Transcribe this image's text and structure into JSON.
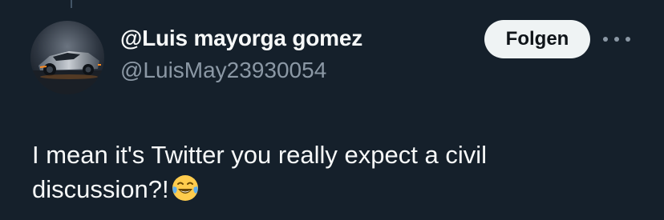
{
  "tweet": {
    "author": {
      "display_name": "@Luis mayorga gomez",
      "handle": "@LuisMay23930054",
      "avatar": "car-avatar"
    },
    "follow_label": "Folgen",
    "more_icon": "more-horizontal-icon",
    "text_line1": "I mean it's Twitter you really expect a civil",
    "text_line2": "discussion?!",
    "emoji": "tears-of-joy-emoji"
  },
  "colors": {
    "background": "#15202b",
    "primary_text": "#f7f9f9",
    "secondary_text": "#8b98a5",
    "follow_button_bg": "#eff3f4",
    "follow_button_text": "#0f1419"
  }
}
